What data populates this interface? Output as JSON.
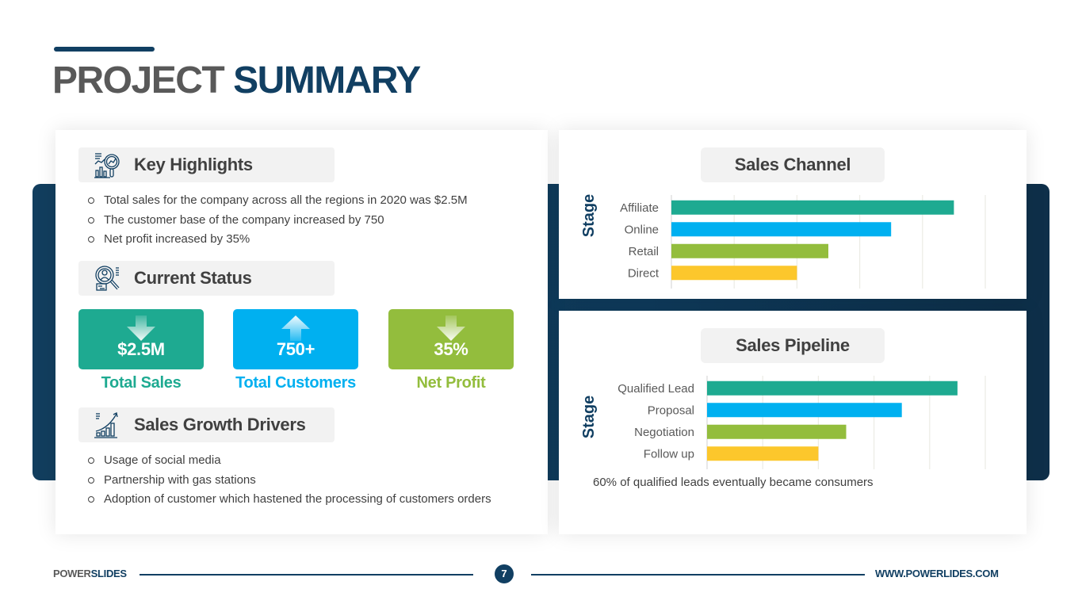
{
  "header": {
    "title_part1": "PROJECT",
    "title_part2": "SUMMARY"
  },
  "key_highlights": {
    "title": "Key Highlights",
    "icon": "analytics-magnifier-icon",
    "items": [
      "Total sales for the company across all the regions in 2020 was $2.5M",
      "The customer base of the company increased by 750",
      "Net profit increased by 35%"
    ]
  },
  "current_status": {
    "title": "Current Status",
    "icon": "user-search-icon",
    "stats": [
      {
        "value": "$2.5M",
        "label": "Total Sales",
        "direction": "down",
        "color": "#1eaa91"
      },
      {
        "value": "750+",
        "label": "Total Customers",
        "direction": "up",
        "color": "#00b0f0"
      },
      {
        "value": "35%",
        "label": "Net Profit",
        "direction": "down",
        "color": "#93bd3d"
      }
    ]
  },
  "sales_growth_drivers": {
    "title": "Sales Growth Drivers",
    "icon": "growth-chart-icon",
    "items": [
      "Usage of social media",
      "Partnership with gas stations",
      "Adoption of customer which hastened the processing of customers orders"
    ]
  },
  "colors": {
    "navy": "#113f62",
    "teal": "#1eaa91",
    "blue": "#00b0f0",
    "green": "#93bd3d",
    "yellow": "#fcc72c",
    "gray_text": "#404040"
  },
  "chart_data": [
    {
      "type": "bar",
      "orientation": "horizontal",
      "title": "Sales Channel",
      "ylabel": "Stage",
      "xlabel": "",
      "categories": [
        "Affiliate",
        "Online",
        "Retail",
        "Direct"
      ],
      "values": [
        4.5,
        3.5,
        2.5,
        2.0
      ],
      "colors": [
        "#1eaa91",
        "#00b0f0",
        "#93bd3d",
        "#fcc72c"
      ],
      "xlim": [
        0,
        5
      ],
      "grid": true,
      "x_tick_labels_visible": false
    },
    {
      "type": "bar",
      "orientation": "horizontal",
      "title": "Sales Pipeline",
      "ylabel": "Stage",
      "xlabel": "",
      "categories": [
        "Qualified Lead",
        "Proposal",
        "Negotiation",
        "Follow up"
      ],
      "values": [
        4.5,
        3.5,
        2.5,
        2.0
      ],
      "colors": [
        "#1eaa91",
        "#00b0f0",
        "#93bd3d",
        "#fcc72c"
      ],
      "xlim": [
        0,
        5
      ],
      "grid": true,
      "x_tick_labels_visible": false,
      "annotation": "60% of qualified leads eventually became consumers"
    }
  ],
  "footer": {
    "brand_part1": "POWER",
    "brand_part2": "SLIDES",
    "page_number": "7",
    "url": "WWW.POWERLIDES.COM"
  }
}
